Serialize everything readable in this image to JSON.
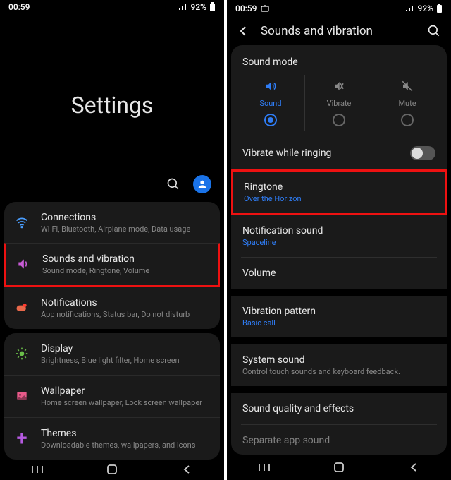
{
  "status": {
    "time": "00:59",
    "battery": "92%"
  },
  "screen1": {
    "title": "Settings",
    "items": [
      {
        "icon": "wifi",
        "title": "Connections",
        "sub": "Wi-Fi, Bluetooth, Airplane mode, Data usage"
      },
      {
        "icon": "sound",
        "title": "Sounds and vibration",
        "sub": "Sound mode, Ringtone, Volume",
        "highlight": true
      },
      {
        "icon": "notif",
        "title": "Notifications",
        "sub": "App notifications, Status bar, Do not disturb"
      },
      {
        "icon": "display",
        "title": "Display",
        "sub": "Brightness, Blue light filter, Home screen"
      },
      {
        "icon": "wallpaper",
        "title": "Wallpaper",
        "sub": "Home screen wallpaper, Lock screen wallpaper"
      },
      {
        "icon": "themes",
        "title": "Themes",
        "sub": "Downloadable themes, wallpapers, and icons"
      }
    ]
  },
  "screen2": {
    "header": "Sounds and vibration",
    "sound_mode_label": "Sound mode",
    "modes": [
      {
        "label": "Sound",
        "icon": "sound-on",
        "active": true
      },
      {
        "label": "Vibrate",
        "icon": "vibrate",
        "active": false
      },
      {
        "label": "Mute",
        "icon": "mute",
        "active": false
      }
    ],
    "vibrate_ringing": {
      "label": "Vibrate while ringing",
      "on": false
    },
    "rows": [
      {
        "title": "Ringtone",
        "sub": "Over the Horizon",
        "subtype": "blue",
        "highlight": true
      },
      {
        "title": "Notification sound",
        "sub": "Spaceline",
        "subtype": "blue"
      },
      {
        "title": "Volume"
      },
      {
        "gap": true
      },
      {
        "title": "Vibration pattern",
        "sub": "Basic call",
        "subtype": "blue"
      },
      {
        "gap": true
      },
      {
        "title": "System sound",
        "sub": "Control touch sounds and keyboard feedback.",
        "subtype": "gray"
      },
      {
        "gap": true
      },
      {
        "title": "Sound quality and effects"
      },
      {
        "title": "Separate app sound",
        "cut": true
      }
    ]
  }
}
